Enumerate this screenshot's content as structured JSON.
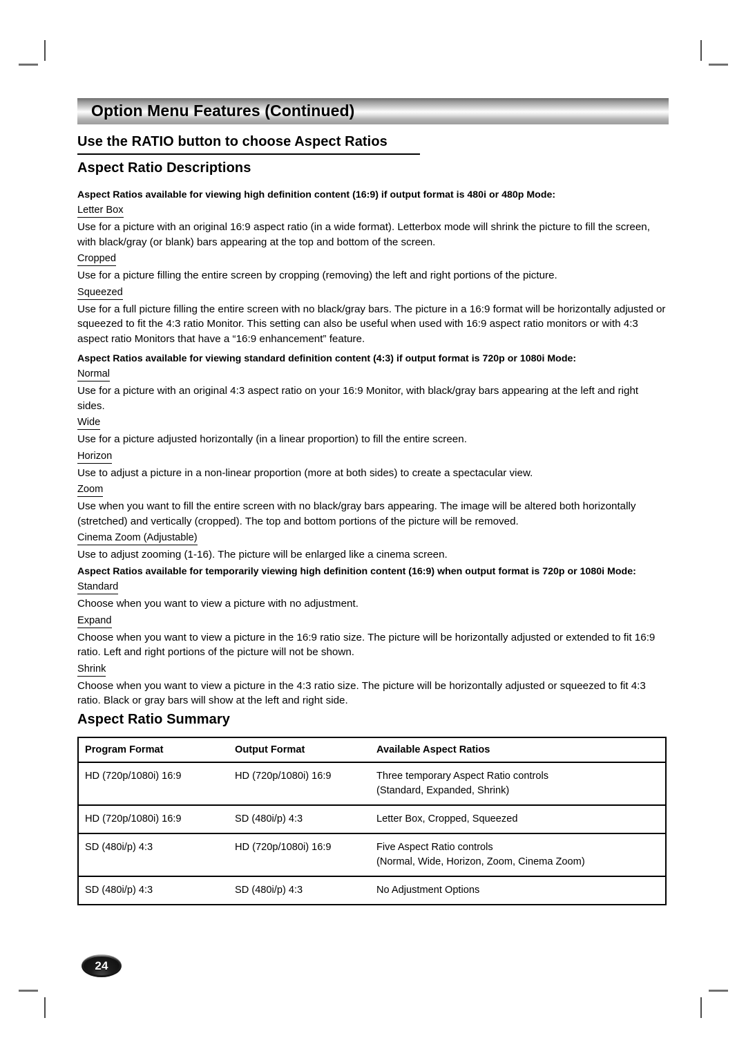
{
  "banner": {
    "title": "Option Menu Features (Continued)"
  },
  "headings": {
    "ratio_button": "Use the RATIO button to choose Aspect Ratios",
    "descriptions": "Aspect Ratio Descriptions",
    "summary": "Aspect Ratio Summary"
  },
  "sections": [
    {
      "lead": "Aspect Ratios available for viewing high definition content (16:9) if output format is 480i or 480p Mode:",
      "entries": [
        {
          "term": "Letter Box",
          "text": "Use for a picture with an original 16:9 aspect ratio (in a wide format).  Letterbox mode will shrink the picture to fill the screen, with black/gray (or blank) bars appearing at the top and bottom of the screen."
        },
        {
          "term": "Cropped",
          "text": "Use for a picture filling the entire screen by cropping (removing) the left and right portions of the picture."
        },
        {
          "term": "Squeezed",
          "text": "Use for a full picture filling the entire screen with no black/gray bars.  The picture in a 16:9 format will be horizontally adjusted or squeezed to fit the 4:3 ratio Monitor.  This setting can also be useful when used with 16:9 aspect ratio monitors or with 4:3 aspect ratio Monitors that have a “16:9 enhancement” feature."
        }
      ]
    },
    {
      "lead": "Aspect Ratios available for viewing standard definition content (4:3) if output format is 720p or 1080i Mode:",
      "entries": [
        {
          "term": "Normal",
          "text": "Use for a picture with an original 4:3 aspect ratio on your 16:9 Monitor, with black/gray bars appearing at the left and right sides."
        },
        {
          "term": "Wide",
          "text": "Use for a picture adjusted horizontally (in a linear proportion) to fill the entire screen."
        },
        {
          "term": "Horizon",
          "text": "Use to adjust a picture in a non-linear proportion (more at both sides) to create a spectacular view."
        },
        {
          "term": "Zoom",
          "text": "Use when you want to fill the entire screen with no black/gray bars appearing.  The image will be altered both horizontally (stretched) and vertically (cropped).  The top and bottom portions of the picture will be removed."
        },
        {
          "term": "Cinema Zoom (Adjustable)",
          "text": "Use to adjust zooming (1-16). The picture will be enlarged like a cinema screen."
        }
      ]
    },
    {
      "lead": "Aspect Ratios available for temporarily viewing high definition content (16:9) when output format is 720p or 1080i Mode:",
      "entries": [
        {
          "term": "Standard",
          "text": "Choose when you want to view a picture with no adjustment."
        },
        {
          "term": "Expand",
          "text": "Choose when you want to view a picture in the 16:9 ratio size. The picture will be horizontally adjusted or extended to fit 16:9 ratio. Left and right portions of the picture will not be shown."
        },
        {
          "term": "Shrink",
          "text": "Choose when you want to view a picture in the 4:3 ratio size. The picture will be horizontally adjusted or squeezed to fit 4:3 ratio. Black or gray bars will show at the left and right side."
        }
      ]
    }
  ],
  "table": {
    "headers": [
      "Program Format",
      "Output Format",
      "Available Aspect Ratios"
    ],
    "rows": [
      {
        "program_format": "HD (720p/1080i) 16:9",
        "output_format": "HD (720p/1080i) 16:9",
        "ratios_line1": "Three temporary Aspect Ratio controls",
        "ratios_line2": "(Standard, Expanded, Shrink)"
      },
      {
        "program_format": "HD (720p/1080i) 16:9",
        "output_format": "SD (480i/p) 4:3",
        "ratios_line1": "Letter Box, Cropped, Squeezed",
        "ratios_line2": ""
      },
      {
        "program_format": "SD (480i/p) 4:3",
        "output_format": "HD (720p/1080i) 16:9",
        "ratios_line1": "Five Aspect Ratio controls",
        "ratios_line2": "(Normal, Wide, Horizon, Zoom, Cinema Zoom)"
      },
      {
        "program_format": "SD (480i/p) 4:3",
        "output_format": "SD (480i/p) 4:3",
        "ratios_line1": "No Adjustment Options",
        "ratios_line2": ""
      }
    ]
  },
  "footer": {
    "page_number": "24"
  }
}
